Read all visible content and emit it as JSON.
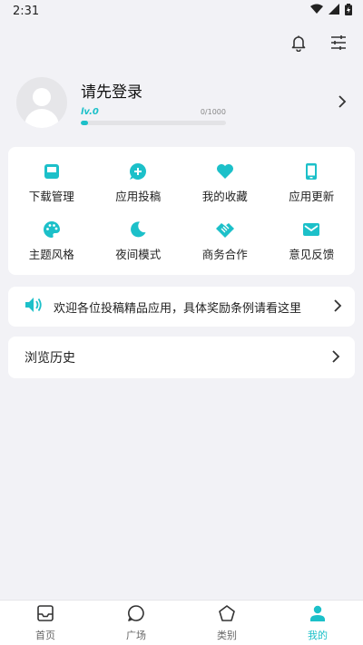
{
  "status_bar": {
    "time": "2:31"
  },
  "profile": {
    "title": "请先登录",
    "level": "lv.0",
    "exp": "0/1000",
    "progress_fraction": 0.0
  },
  "grid": {
    "items": [
      {
        "label": "下载管理",
        "icon": "inbox-icon"
      },
      {
        "label": "应用投稿",
        "icon": "add-chat-icon"
      },
      {
        "label": "我的收藏",
        "icon": "heart-icon"
      },
      {
        "label": "应用更新",
        "icon": "phone-icon"
      },
      {
        "label": "主题风格",
        "icon": "palette-icon"
      },
      {
        "label": "夜间模式",
        "icon": "moon-icon"
      },
      {
        "label": "商务合作",
        "icon": "handshake-icon"
      },
      {
        "label": "意见反馈",
        "icon": "mail-icon"
      }
    ]
  },
  "notice": {
    "text": "欢迎各位投稿精品应用，具体奖励条例请看这里"
  },
  "history": {
    "label": "浏览历史"
  },
  "bottom_nav": {
    "items": [
      {
        "label": "首页",
        "icon": "home-inbox-icon",
        "active": false
      },
      {
        "label": "广场",
        "icon": "chat-bubble-icon",
        "active": false
      },
      {
        "label": "类别",
        "icon": "pentagon-icon",
        "active": false
      },
      {
        "label": "我的",
        "icon": "person-icon",
        "active": true
      }
    ]
  },
  "colors": {
    "accent": "#1cc0c9",
    "background": "#f2f2f6",
    "card": "#ffffff"
  }
}
